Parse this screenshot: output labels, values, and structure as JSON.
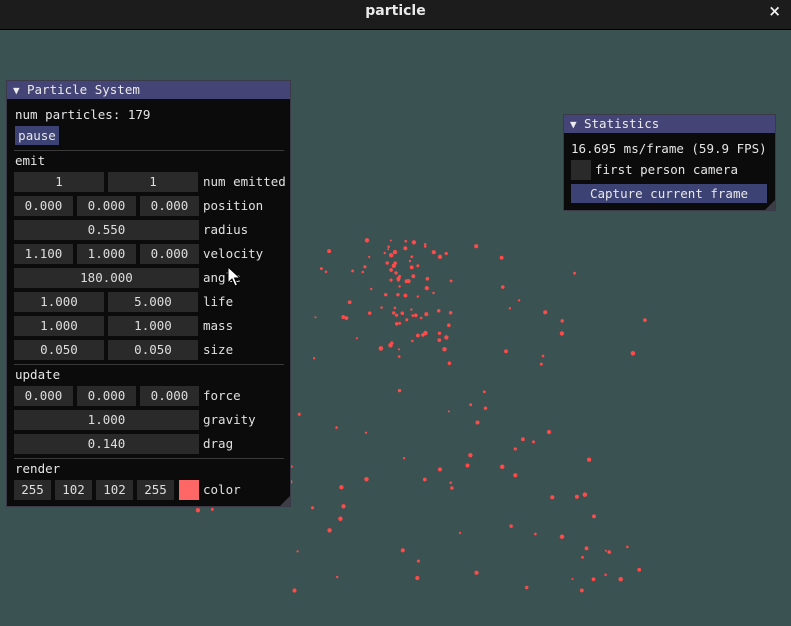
{
  "window": {
    "title": "particle",
    "close_icon": "×"
  },
  "particle_system": {
    "header": "Particle System",
    "num_particles": "num particles: 179",
    "pause": "pause",
    "emit": {
      "section": "emit",
      "num_emitted": {
        "values": [
          "1",
          "1"
        ],
        "label": "num emitted"
      },
      "position": {
        "values": [
          "0.000",
          "0.000",
          "0.000"
        ],
        "label": "position"
      },
      "radius": {
        "value": "0.550",
        "label": "radius"
      },
      "velocity": {
        "values": [
          "1.100",
          "1.000",
          "0.000"
        ],
        "label": "velocity"
      },
      "angle": {
        "value": "180.000",
        "label": "angle"
      },
      "life": {
        "values": [
          "1.000",
          "5.000"
        ],
        "label": "life"
      },
      "mass": {
        "values": [
          "1.000",
          "1.000"
        ],
        "label": "mass"
      },
      "size": {
        "values": [
          "0.050",
          "0.050"
        ],
        "label": "size"
      }
    },
    "update": {
      "section": "update",
      "force": {
        "values": [
          "0.000",
          "0.000",
          "0.000"
        ],
        "label": "force"
      },
      "gravity": {
        "value": "1.000",
        "label": "gravity"
      },
      "drag": {
        "value": "0.140",
        "label": "drag"
      }
    },
    "render": {
      "section": "render",
      "color": {
        "values": [
          "255",
          "102",
          "102",
          "255"
        ],
        "label": "color",
        "swatch": "#ff6666"
      }
    }
  },
  "statistics": {
    "header": "Statistics",
    "frame_time": "16.695 ms/frame (59.9 FPS)",
    "first_person_camera": {
      "label": "first person camera",
      "checked": false
    },
    "capture_button": "Capture current frame"
  },
  "colors": {
    "background": "#3a5252",
    "panel_bg": "#0b0b0b",
    "header_bg": "#444476",
    "button": "#3c4274",
    "field": "#2a2a2a",
    "particle": "#ff4a4a"
  }
}
